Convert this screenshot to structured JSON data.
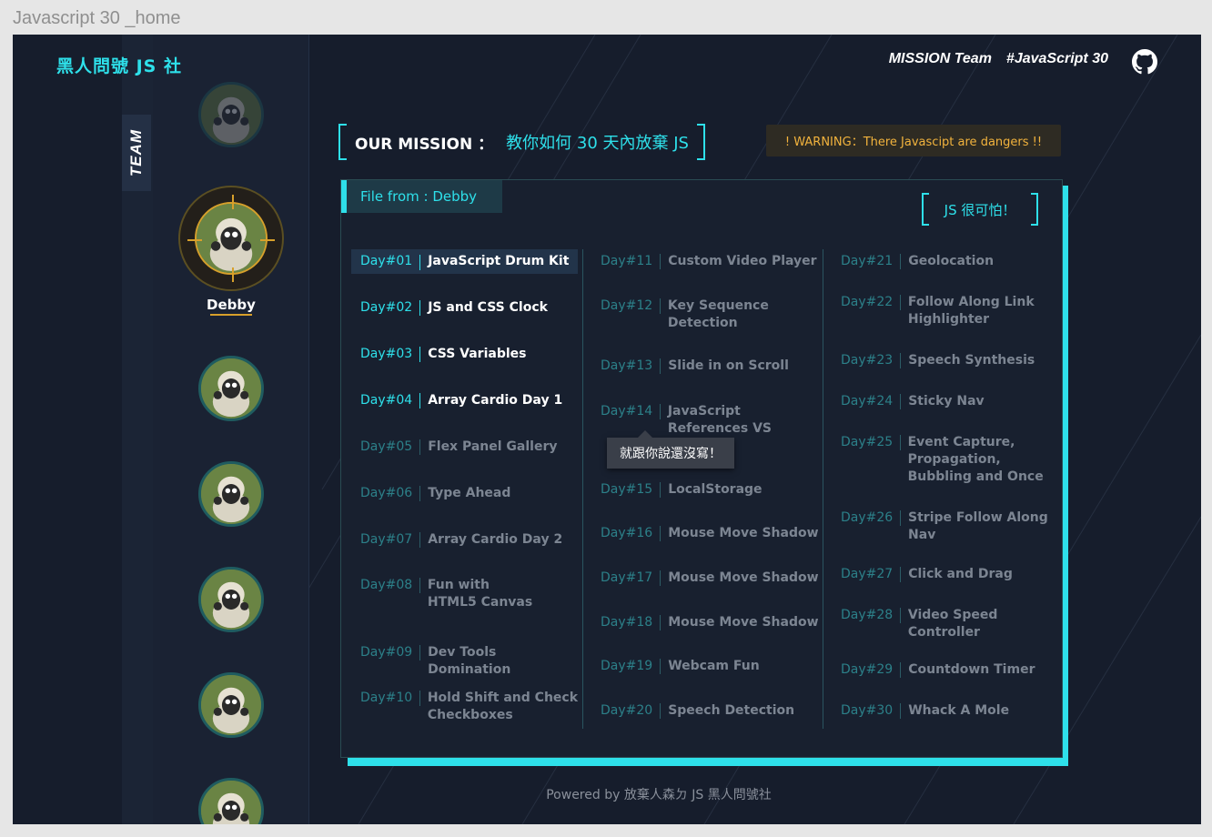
{
  "window": {
    "title": "Javascript 30 _home"
  },
  "header": {
    "brand": "黑人問號 JS 社",
    "nav": [
      "MISSION Team",
      "#JavaScript 30"
    ],
    "github_icon": "github-icon"
  },
  "sidebar": {
    "tab_label": "TEAM",
    "active_member": "Debby"
  },
  "mission": {
    "label": "OUR MISSION ：",
    "text": "教你如何 30 天內放棄 JS"
  },
  "warning": "! WARNING：There Javascipt are dangers !!",
  "panel": {
    "file_tab": "File from : Debby",
    "scary": "JS 很可怕！",
    "tooltip": "就跟你說還沒寫！",
    "days": [
      {
        "num": "Day#01",
        "title": "JavaScript Drum Kit"
      },
      {
        "num": "Day#02",
        "title": "JS and CSS Clock"
      },
      {
        "num": "Day#03",
        "title": "CSS Variables"
      },
      {
        "num": "Day#04",
        "title": "Array Cardio Day 1"
      },
      {
        "num": "Day#05",
        "title": "Flex Panel Gallery"
      },
      {
        "num": "Day#06",
        "title": "Type Ahead"
      },
      {
        "num": "Day#07",
        "title": "Array Cardio Day 2"
      },
      {
        "num": "Day#08",
        "title": "Fun with HTML5 Canvas"
      },
      {
        "num": "Day#09",
        "title": "Dev Tools Domination"
      },
      {
        "num": "Day#10",
        "title": "Hold Shift and Check Checkboxes"
      },
      {
        "num": "Day#11",
        "title": "Custom Video Player"
      },
      {
        "num": "Day#12",
        "title": "Key Sequence Detection"
      },
      {
        "num": "Day#13",
        "title": "Slide in on Scroll"
      },
      {
        "num": "Day#14",
        "title": "JavaScript References VS"
      },
      {
        "num": "Day#15",
        "title": "LocalStorage"
      },
      {
        "num": "Day#16",
        "title": "Mouse Move Shadow"
      },
      {
        "num": "Day#17",
        "title": "Mouse Move Shadow"
      },
      {
        "num": "Day#18",
        "title": "Mouse Move Shadow"
      },
      {
        "num": "Day#19",
        "title": "Webcam Fun"
      },
      {
        "num": "Day#20",
        "title": "Speech Detection"
      },
      {
        "num": "Day#21",
        "title": "Geolocation"
      },
      {
        "num": "Day#22",
        "title": "Follow Along Link Highlighter"
      },
      {
        "num": "Day#23",
        "title": "Speech Synthesis"
      },
      {
        "num": "Day#24",
        "title": "Sticky Nav"
      },
      {
        "num": "Day#25",
        "title": "Event Capture, Propagation, Bubbling and Once"
      },
      {
        "num": "Day#26",
        "title": "Stripe Follow Along Nav"
      },
      {
        "num": "Day#27",
        "title": "Click and Drag"
      },
      {
        "num": "Day#28",
        "title": "Video Speed Controller"
      },
      {
        "num": "Day#29",
        "title": "Countdown Timer"
      },
      {
        "num": "Day#30",
        "title": "Whack A Mole"
      }
    ]
  },
  "footer": "Powered by 放棄人森ㄉ JS 黑人問號社",
  "colors": {
    "accent": "#2ee0ea",
    "background": "#161d2c",
    "warning": "#f2b33d",
    "highlight": "#d7a02b"
  }
}
